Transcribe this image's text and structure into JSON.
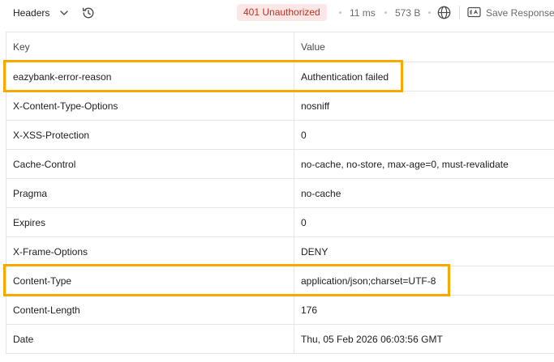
{
  "toolbar": {
    "tab_label": "Headers",
    "status": "401 Unauthorized",
    "time": "11 ms",
    "size": "573 B",
    "save_label": "Save Response",
    "icons": [
      "chevron-down-icon",
      "history-icon",
      "globe-icon",
      "save-response-icon"
    ],
    "colors": {
      "status_bg": "#fbe7e5",
      "status_text": "#bf3126",
      "highlight": "#f9a800"
    }
  },
  "table": {
    "headers": [
      "Key",
      "Value"
    ],
    "rows": [
      {
        "key": "eazybank-error-reason",
        "value": "Authentication failed",
        "highlighted": true
      },
      {
        "key": "X-Content-Type-Options",
        "value": "nosniff",
        "highlighted": false
      },
      {
        "key": "X-XSS-Protection",
        "value": "0",
        "highlighted": false
      },
      {
        "key": "Cache-Control",
        "value": "no-cache, no-store, max-age=0, must-revalidate",
        "highlighted": false
      },
      {
        "key": "Pragma",
        "value": "no-cache",
        "highlighted": false
      },
      {
        "key": "Expires",
        "value": "0",
        "highlighted": false
      },
      {
        "key": "X-Frame-Options",
        "value": "DENY",
        "highlighted": false
      },
      {
        "key": "Content-Type",
        "value": "application/json;charset=UTF-8",
        "highlighted": true
      },
      {
        "key": "Content-Length",
        "value": "176",
        "highlighted": false
      },
      {
        "key": "Date",
        "value": "Thu, 05 Feb 2026 06:03:56 GMT",
        "highlighted": false
      }
    ]
  }
}
